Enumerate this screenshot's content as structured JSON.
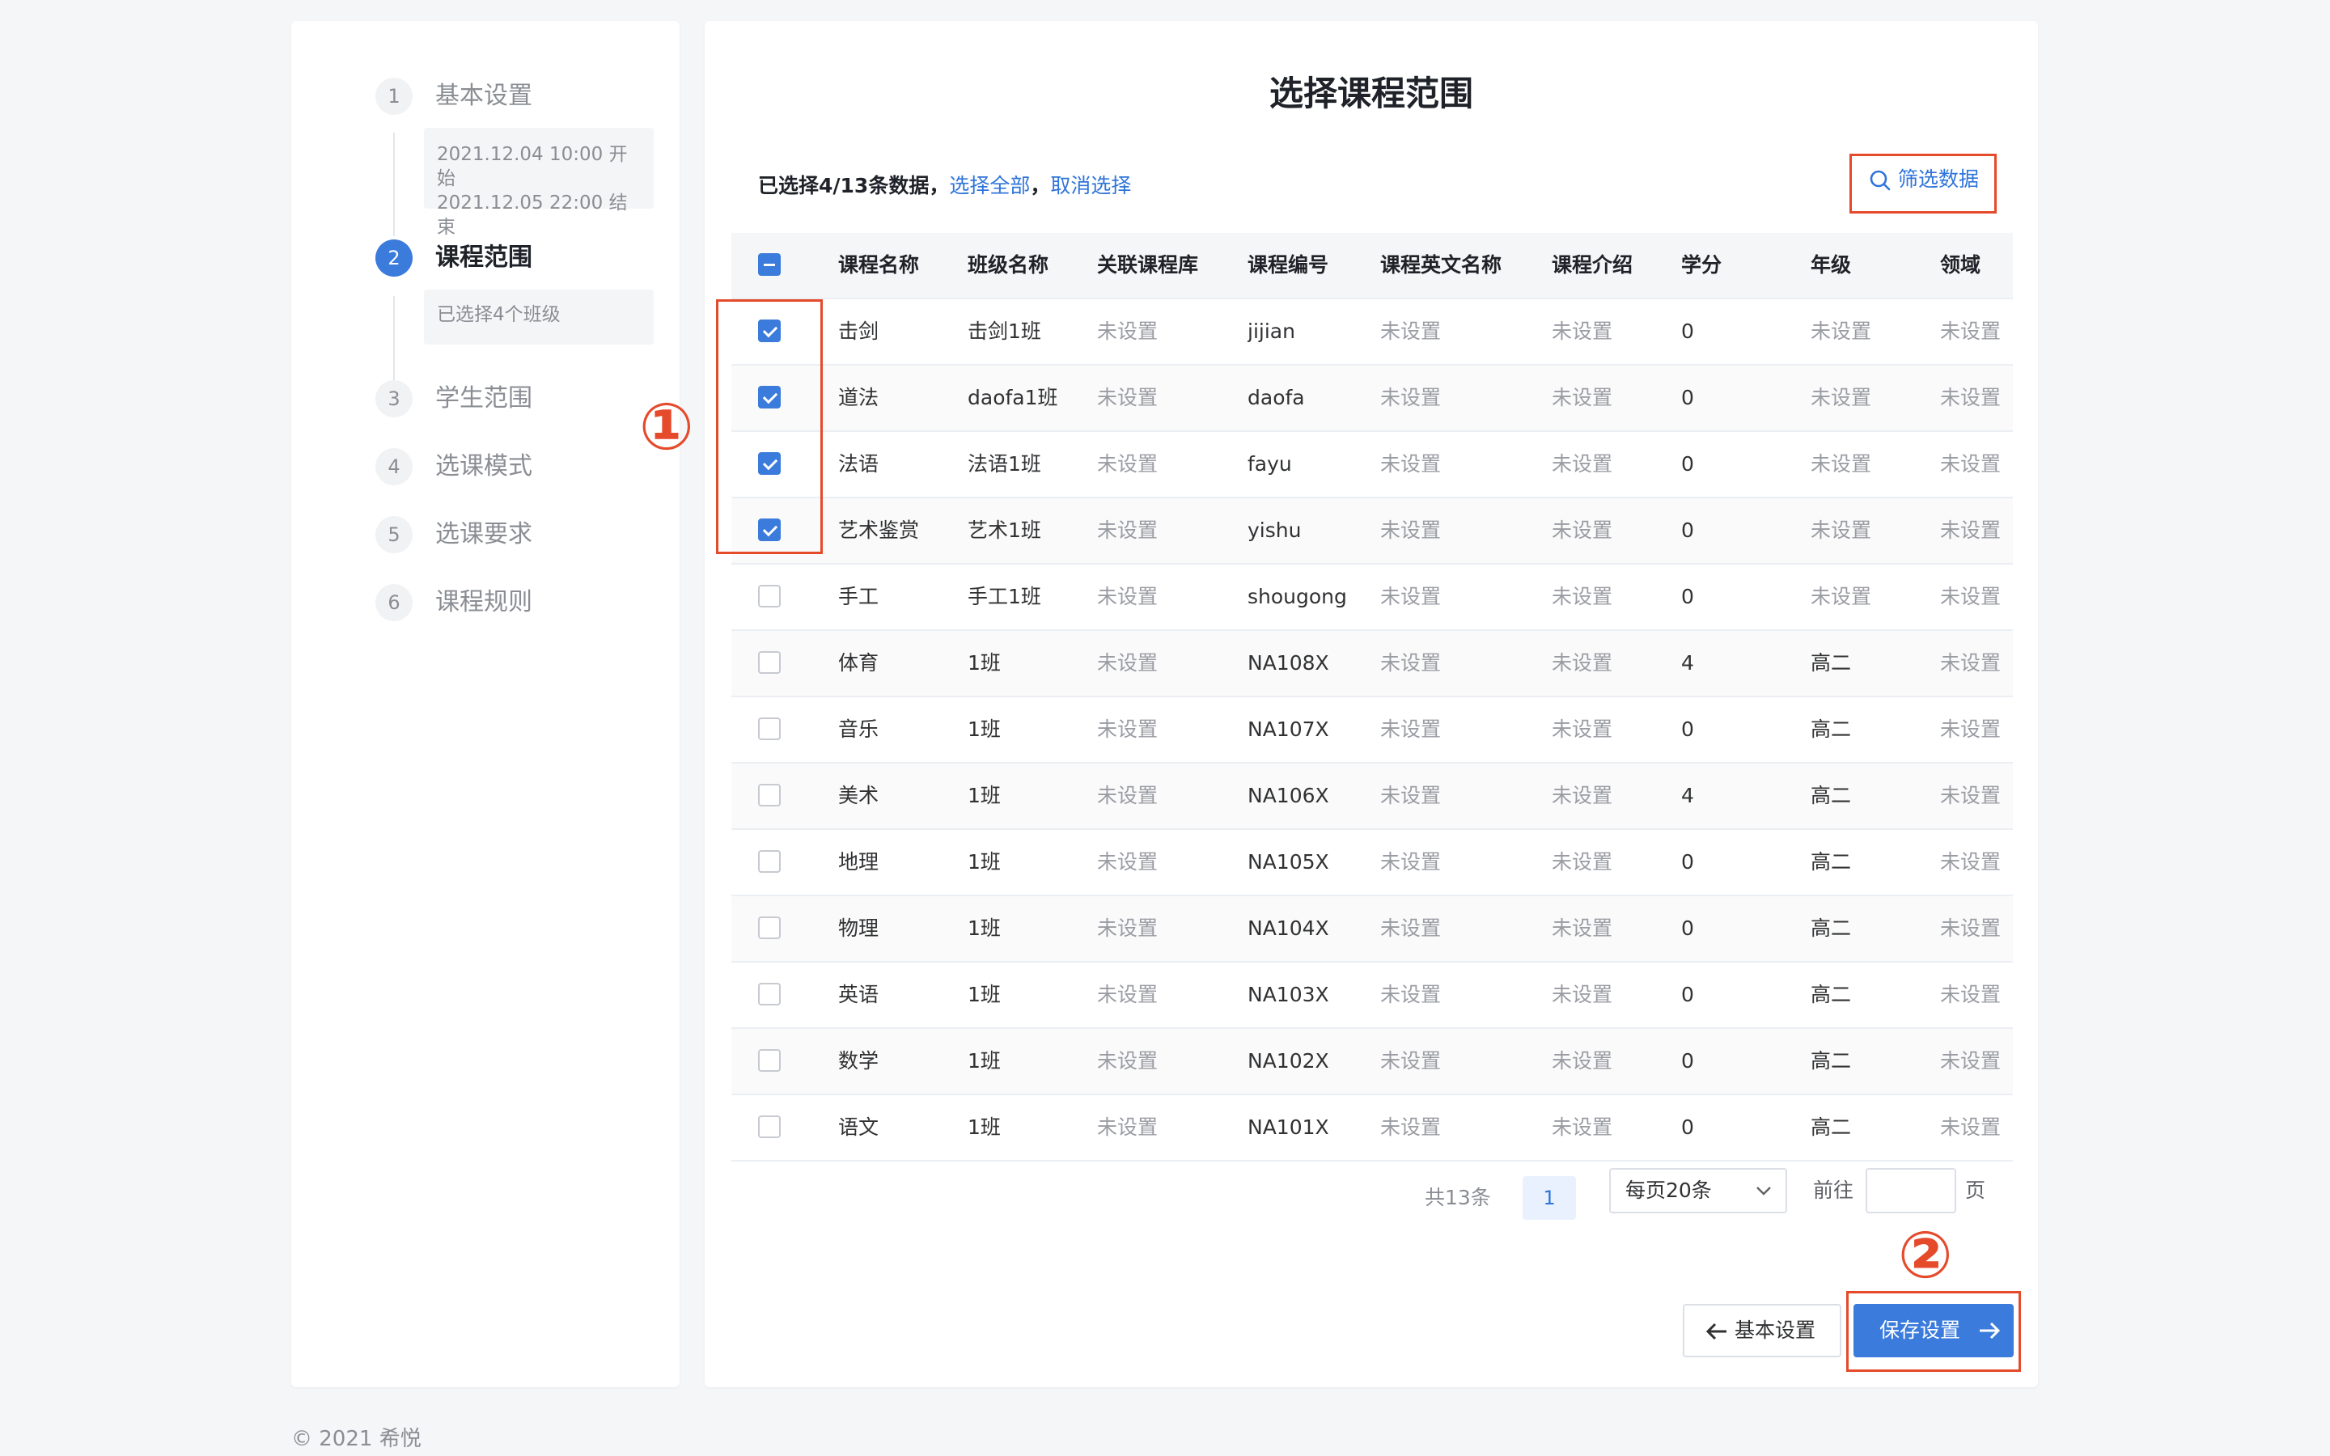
{
  "steps": [
    {
      "number": "1",
      "title": "基本设置",
      "desc_lines": [
        "2021.12.04 10:00 开始",
        "2021.12.05 22:00 结束"
      ]
    },
    {
      "number": "2",
      "title": "课程范围",
      "desc": "已选择4个班级"
    },
    {
      "number": "3",
      "title": "学生范围"
    },
    {
      "number": "4",
      "title": "选课模式"
    },
    {
      "number": "5",
      "title": "选课要求"
    },
    {
      "number": "6",
      "title": "课程规则"
    }
  ],
  "main": {
    "title": "选择课程范围",
    "selection_info": "已选择4/13条数据，",
    "select_all": "选择全部",
    "separator": "，",
    "cancel_select": "取消选择",
    "filter_label": "筛选数据"
  },
  "table": {
    "headers": [
      "课程名称",
      "班级名称",
      "关联课程库",
      "课程编号",
      "课程英文名称",
      "课程介绍",
      "学分",
      "年级",
      "领域"
    ],
    "rows": [
      {
        "checked": true,
        "cells": [
          "击剑",
          "击剑1班",
          "未设置",
          "jijian",
          "未设置",
          "未设置",
          "0",
          "未设置",
          "未设置"
        ]
      },
      {
        "checked": true,
        "cells": [
          "道法",
          "daofa1班",
          "未设置",
          "daofa",
          "未设置",
          "未设置",
          "0",
          "未设置",
          "未设置"
        ]
      },
      {
        "checked": true,
        "cells": [
          "法语",
          "法语1班",
          "未设置",
          "fayu",
          "未设置",
          "未设置",
          "0",
          "未设置",
          "未设置"
        ]
      },
      {
        "checked": true,
        "cells": [
          "艺术鉴赏",
          "艺术1班",
          "未设置",
          "yishu",
          "未设置",
          "未设置",
          "0",
          "未设置",
          "未设置"
        ]
      },
      {
        "checked": false,
        "cells": [
          "手工",
          "手工1班",
          "未设置",
          "shougong",
          "未设置",
          "未设置",
          "0",
          "未设置",
          "未设置"
        ]
      },
      {
        "checked": false,
        "cells": [
          "体育",
          "1班",
          "未设置",
          "NA108X",
          "未设置",
          "未设置",
          "4",
          "高二",
          "未设置"
        ]
      },
      {
        "checked": false,
        "cells": [
          "音乐",
          "1班",
          "未设置",
          "NA107X",
          "未设置",
          "未设置",
          "0",
          "高二",
          "未设置"
        ]
      },
      {
        "checked": false,
        "cells": [
          "美术",
          "1班",
          "未设置",
          "NA106X",
          "未设置",
          "未设置",
          "4",
          "高二",
          "未设置"
        ]
      },
      {
        "checked": false,
        "cells": [
          "地理",
          "1班",
          "未设置",
          "NA105X",
          "未设置",
          "未设置",
          "0",
          "高二",
          "未设置"
        ]
      },
      {
        "checked": false,
        "cells": [
          "物理",
          "1班",
          "未设置",
          "NA104X",
          "未设置",
          "未设置",
          "0",
          "高二",
          "未设置"
        ]
      },
      {
        "checked": false,
        "cells": [
          "英语",
          "1班",
          "未设置",
          "NA103X",
          "未设置",
          "未设置",
          "0",
          "高二",
          "未设置"
        ]
      },
      {
        "checked": false,
        "cells": [
          "数学",
          "1班",
          "未设置",
          "NA102X",
          "未设置",
          "未设置",
          "0",
          "高二",
          "未设置"
        ]
      },
      {
        "checked": false,
        "cells": [
          "语文",
          "1班",
          "未设置",
          "NA101X",
          "未设置",
          "未设置",
          "0",
          "高二",
          "未设置"
        ]
      }
    ]
  },
  "pagination": {
    "total": "共13条",
    "current_page": "1",
    "page_size": "每页20条",
    "goto_label": "前往",
    "goto_suffix": "页"
  },
  "buttons": {
    "back": "基本设置",
    "save": "保存设置"
  },
  "annotations": {
    "one": "①",
    "two": "②"
  },
  "footer": "© 2021 希悦",
  "icons": {
    "filter": "search-icon",
    "back": "arrow-left-icon",
    "save": "arrow-right-icon",
    "select": "chevron-down-icon"
  },
  "colors": {
    "accent": "#3a7bdc",
    "annotation": "#e54a2b"
  }
}
